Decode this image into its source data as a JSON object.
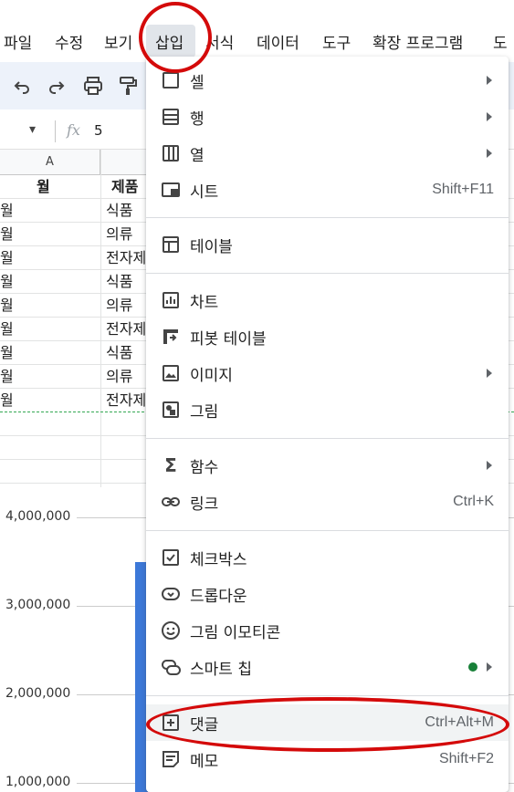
{
  "menubar": {
    "items": [
      "파일",
      "수정",
      "보기",
      "삽입",
      "서식",
      "데이터",
      "도구",
      "확장 프로그램",
      "도"
    ]
  },
  "formula": {
    "cell_ref_dropdown": "▾",
    "fx": "fx",
    "value": "5"
  },
  "grid": {
    "col_a_header": "A",
    "header_row": {
      "a": "월",
      "b": "제품"
    },
    "rows": [
      {
        "a": "월",
        "b": "식품"
      },
      {
        "a": "월",
        "b": "의류"
      },
      {
        "a": "월",
        "b": "전자제"
      },
      {
        "a": "월",
        "b": "식품"
      },
      {
        "a": "월",
        "b": "의류"
      },
      {
        "a": "월",
        "b": "전자제"
      },
      {
        "a": "월",
        "b": "식품"
      },
      {
        "a": "월",
        "b": "의류"
      },
      {
        "a": "월",
        "b": "전자제"
      }
    ]
  },
  "chart_data": {
    "type": "bar",
    "yticks": [
      "4,000,000",
      "3,000,000",
      "2,000,000",
      "1,000,000"
    ],
    "ytick_values": [
      4000000,
      3000000,
      2000000,
      1000000
    ],
    "colors": {
      "bar": "#3c78d8"
    }
  },
  "insert_menu": {
    "items": [
      {
        "label": "셀",
        "icon": "cell-icon",
        "submenu": true
      },
      {
        "label": "행",
        "icon": "rows-icon",
        "submenu": true
      },
      {
        "label": "열",
        "icon": "columns-icon",
        "submenu": true
      },
      {
        "label": "시트",
        "icon": "sheet-icon",
        "shortcut": "Shift+F11"
      },
      {
        "label": "테이블",
        "icon": "table-icon"
      },
      {
        "label": "차트",
        "icon": "chart-icon"
      },
      {
        "label": "피봇 테이블",
        "icon": "pivot-table-icon"
      },
      {
        "label": "이미지",
        "icon": "image-icon",
        "submenu": true
      },
      {
        "label": "그림",
        "icon": "drawing-icon"
      },
      {
        "label": "함수",
        "icon": "sigma-icon",
        "submenu": true
      },
      {
        "label": "링크",
        "icon": "link-icon",
        "shortcut": "Ctrl+K"
      },
      {
        "label": "체크박스",
        "icon": "checkbox-icon"
      },
      {
        "label": "드롭다운",
        "icon": "dropdown-icon"
      },
      {
        "label": "그림 이모티콘",
        "icon": "emoji-icon"
      },
      {
        "label": "스마트 칩",
        "icon": "smart-chip-icon",
        "submenu": true
      },
      {
        "label": "댓글",
        "icon": "comment-icon",
        "shortcut": "Ctrl+Alt+M"
      },
      {
        "label": "메모",
        "icon": "note-icon",
        "shortcut": "Shift+F2"
      }
    ]
  },
  "colors": {
    "annotation": "#d40a0a",
    "smart_chip_dot": "#188038",
    "menu_highlight": "#f1f3f4",
    "toolbar_bg": "#edf2fa"
  }
}
